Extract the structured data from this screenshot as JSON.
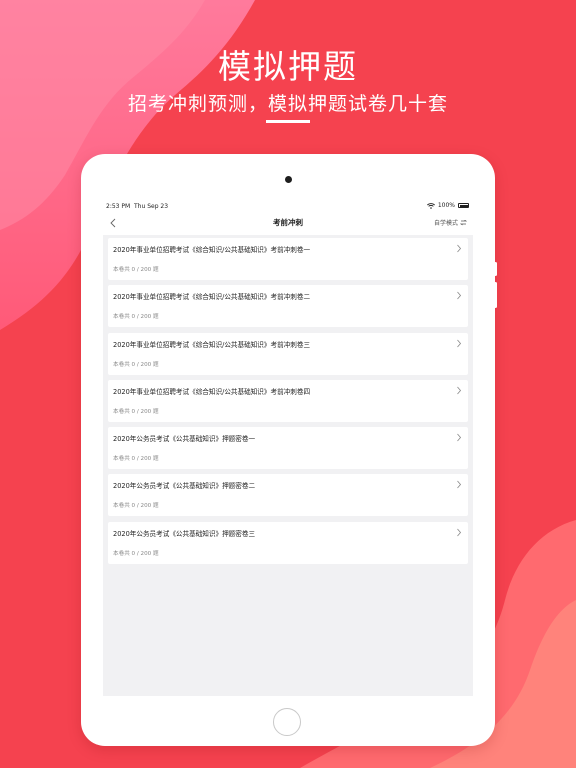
{
  "promo": {
    "title": "模拟押题",
    "subtitle": "招考冲刺预测，模拟押题试卷几十套"
  },
  "colors": {
    "background": "#f5424f",
    "accent_red": "#ef3e48",
    "card_background": "#ffffff",
    "screen_background": "#f1f1f3"
  },
  "status_bar": {
    "time": "2:53 PM",
    "date": "Thu Sep 23",
    "battery": "100%"
  },
  "nav": {
    "title": "考前冲刺",
    "mode_label": "自学模式"
  },
  "papers": [
    {
      "title": "2020年事业单位招聘考试《综合知识/公共基础知识》考前冲刺卷一",
      "count": "本卷共 0 / 200 题"
    },
    {
      "title": "2020年事业单位招聘考试《综合知识/公共基础知识》考前冲刺卷二",
      "count": "本卷共 0 / 200 题"
    },
    {
      "title": "2020年事业单位招聘考试《综合知识/公共基础知识》考前冲刺卷三",
      "count": "本卷共 0 / 200 题"
    },
    {
      "title": "2020年事业单位招聘考试《综合知识/公共基础知识》考前冲刺卷四",
      "count": "本卷共 0 / 200 题"
    },
    {
      "title": "2020年公务员考试《公共基础知识》押题密卷一",
      "count": "本卷共 0 / 200 题"
    },
    {
      "title": "2020年公务员考试《公共基础知识》押题密卷二",
      "count": "本卷共 0 / 200 题"
    },
    {
      "title": "2020年公务员考试《公共基础知识》押题密卷三",
      "count": "本卷共 0 / 200 题"
    }
  ]
}
